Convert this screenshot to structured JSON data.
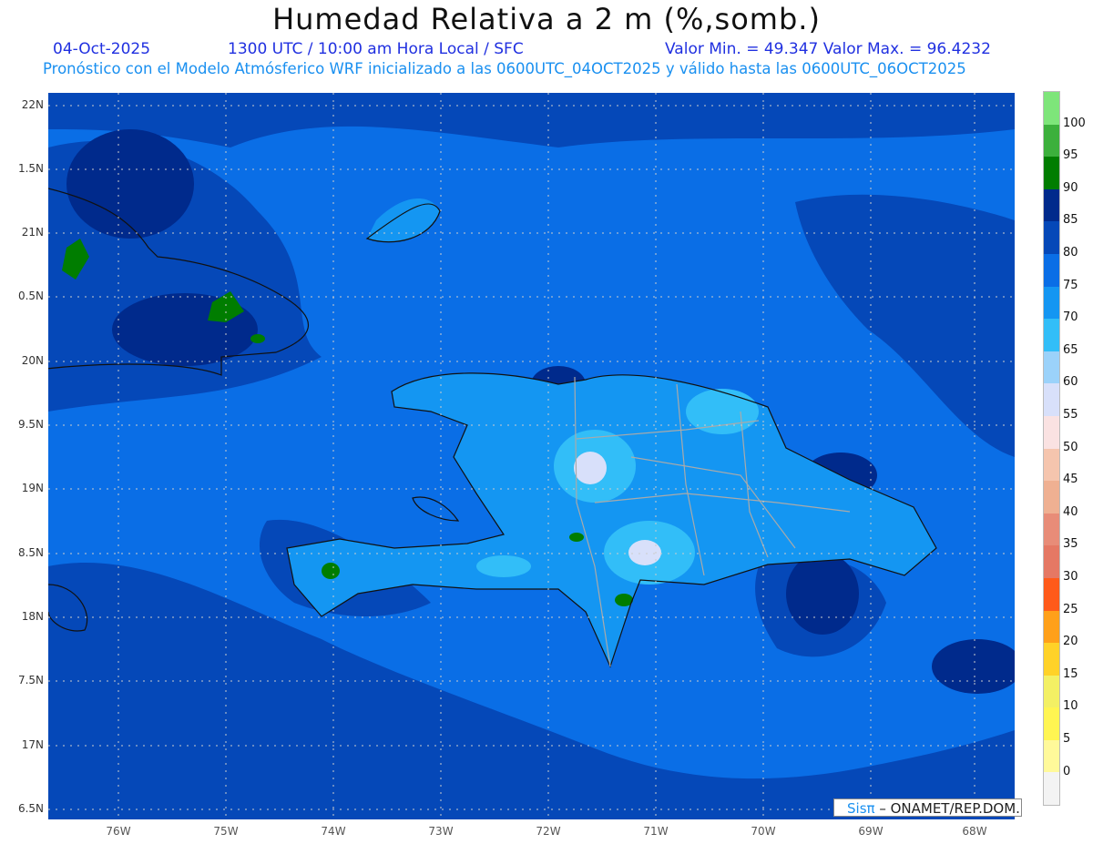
{
  "header": {
    "title": "Humedad Relativa a 2 m (%,somb.)",
    "date": "04-Oct-2025",
    "time": "1300 UTC / 10:00 am Hora Local / SFC",
    "minmax": "Valor Min. = 49.347  Valor Max. = 96.4232",
    "subtitle": "Pronóstico con el Modelo Atmósferico WRF inicializado a las 0600UTC_04OCT2025 y válido hasta las  0600UTC_06OCT2025"
  },
  "lat_labels": [
    "22N",
    "1.5N",
    "21N",
    "0.5N",
    "20N",
    "9.5N",
    "19N",
    "8.5N",
    "18N",
    "7.5N",
    "17N",
    "6.5N"
  ],
  "lon_labels": [
    "76W",
    "75W",
    "74W",
    "73W",
    "72W",
    "71W",
    "70W",
    "69W",
    "68W"
  ],
  "legend": {
    "labels": [
      "100",
      "95",
      "90",
      "85",
      "80",
      "75",
      "70",
      "65",
      "60",
      "55",
      "50",
      "45",
      "40",
      "35",
      "30",
      "25",
      "20",
      "15",
      "10",
      "5",
      "0"
    ],
    "colors": [
      "#7ee57a",
      "#3cb03c",
      "#007d00",
      "#002a8c",
      "#0548b8",
      "#0a6ee6",
      "#1496f2",
      "#32bef8",
      "#9bd2fa",
      "#d8e0fa",
      "#fae2e2",
      "#f5c5ae",
      "#efb092",
      "#e88c78",
      "#e57864",
      "#ff5a1a",
      "#ffa01a",
      "#ffd228",
      "#f3f064",
      "#fff552",
      "#fff99a",
      "#f3f3f3"
    ]
  },
  "credit": {
    "brand": "Sisπ",
    "rest": " – ONAMET/REP.DOM."
  }
}
